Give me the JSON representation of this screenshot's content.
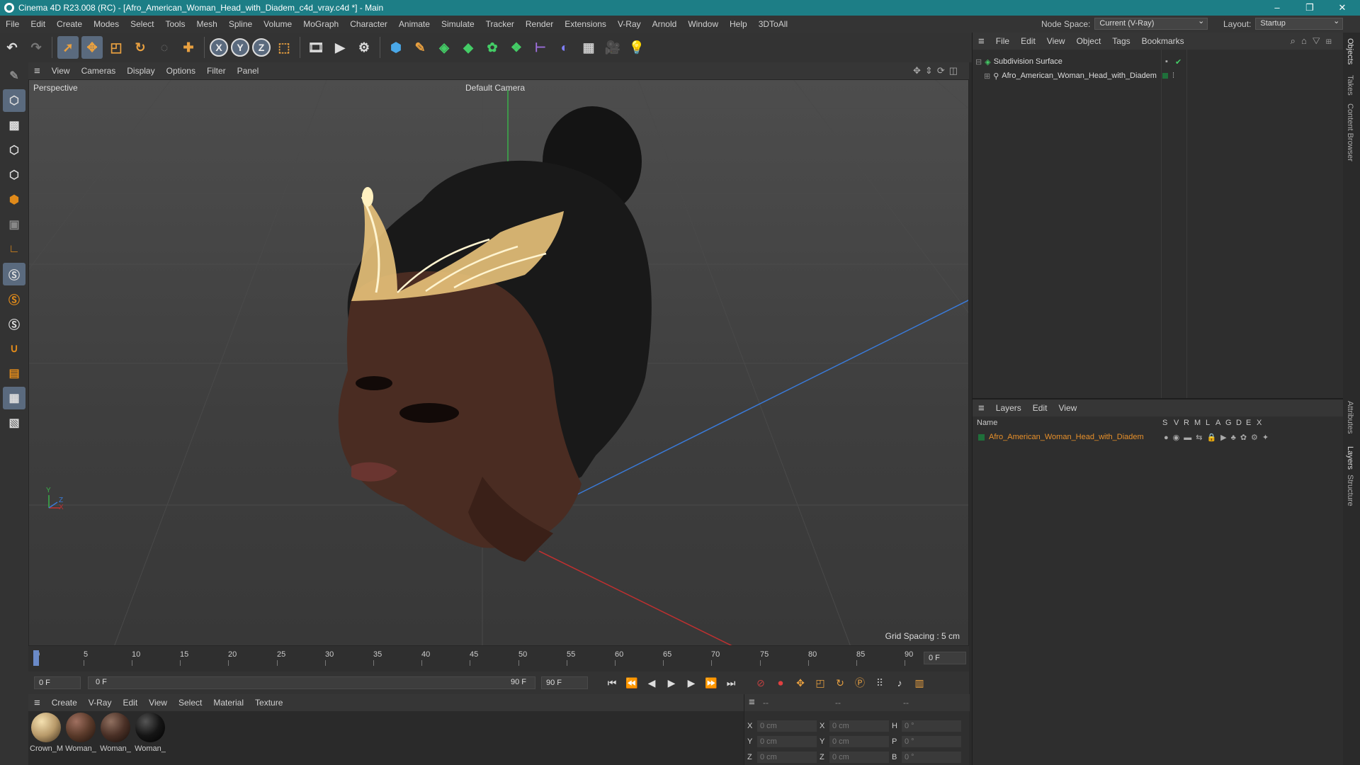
{
  "window": {
    "title": "Cinema 4D R23.008 (RC) - [Afro_American_Woman_Head_with_Diadem_c4d_vray.c4d *] - Main",
    "controls": [
      "–",
      "❐",
      "✕"
    ]
  },
  "menubar": {
    "items": [
      "File",
      "Edit",
      "Create",
      "Modes",
      "Select",
      "Tools",
      "Mesh",
      "Spline",
      "Volume",
      "MoGraph",
      "Character",
      "Animate",
      "Simulate",
      "Tracker",
      "Render",
      "Extensions",
      "V-Ray",
      "Arnold",
      "Window",
      "Help",
      "3DToAll"
    ],
    "node_space_label": "Node Space:",
    "node_space_value": "Current (V-Ray)",
    "layout_label": "Layout:",
    "layout_value": "Startup"
  },
  "toolbar": {
    "axis_x": "X",
    "axis_y": "Y",
    "axis_z": "Z"
  },
  "viewport": {
    "menu": [
      "View",
      "Cameras",
      "Display",
      "Options",
      "Filter",
      "Panel"
    ],
    "label": "Perspective",
    "camera": "Default Camera",
    "grid_spacing": "Grid Spacing : 5 cm",
    "axis_y": "Y",
    "axis_z": "Z",
    "axis_x": "X"
  },
  "timeline": {
    "ticks": [
      "0",
      "5",
      "10",
      "15",
      "20",
      "25",
      "30",
      "35",
      "40",
      "45",
      "50",
      "55",
      "60",
      "65",
      "70",
      "75",
      "80",
      "85",
      "90"
    ],
    "current_frame": "0 F",
    "start_field": "0 F",
    "range_start": "0 F",
    "range_end": "90 F",
    "end_field": "90 F"
  },
  "materials": {
    "menu": [
      "Create",
      "V-Ray",
      "Edit",
      "View",
      "Select",
      "Material",
      "Texture"
    ],
    "items": [
      {
        "label": "Crown_M",
        "color": "#b89a6a"
      },
      {
        "label": "Woman_",
        "color": "#5a3a2a"
      },
      {
        "label": "Woman_",
        "color": "#4a3026"
      },
      {
        "label": "Woman_",
        "color": "#151515"
      }
    ]
  },
  "coords": {
    "headers": [
      "--",
      "--",
      "--"
    ],
    "rows": [
      {
        "l1": "X",
        "v1": "0 cm",
        "l2": "X",
        "v2": "0 cm",
        "l3": "H",
        "v3": "0 °"
      },
      {
        "l1": "Y",
        "v1": "0 cm",
        "l2": "Y",
        "v2": "0 cm",
        "l3": "P",
        "v3": "0 °"
      },
      {
        "l1": "Z",
        "v1": "0 cm",
        "l2": "Z",
        "v2": "0 cm",
        "l3": "B",
        "v3": "0 °"
      }
    ]
  },
  "objects": {
    "menu": [
      "File",
      "Edit",
      "View",
      "Object",
      "Tags",
      "Bookmarks"
    ],
    "rows": [
      "Subdivision Surface",
      "Afro_American_Woman_Head_with_Diadem"
    ]
  },
  "layers": {
    "menu": [
      "Layers",
      "Edit",
      "View"
    ],
    "col_name": "Name",
    "flags": [
      "S",
      "V",
      "R",
      "M",
      "L",
      "A",
      "G",
      "D",
      "E",
      "X"
    ],
    "row_name": "Afro_American_Woman_Head_with_Diadem"
  },
  "sidetabs": [
    "Objects",
    "Takes",
    "Content Browser",
    "Attributes",
    "Layers",
    "Structure"
  ]
}
